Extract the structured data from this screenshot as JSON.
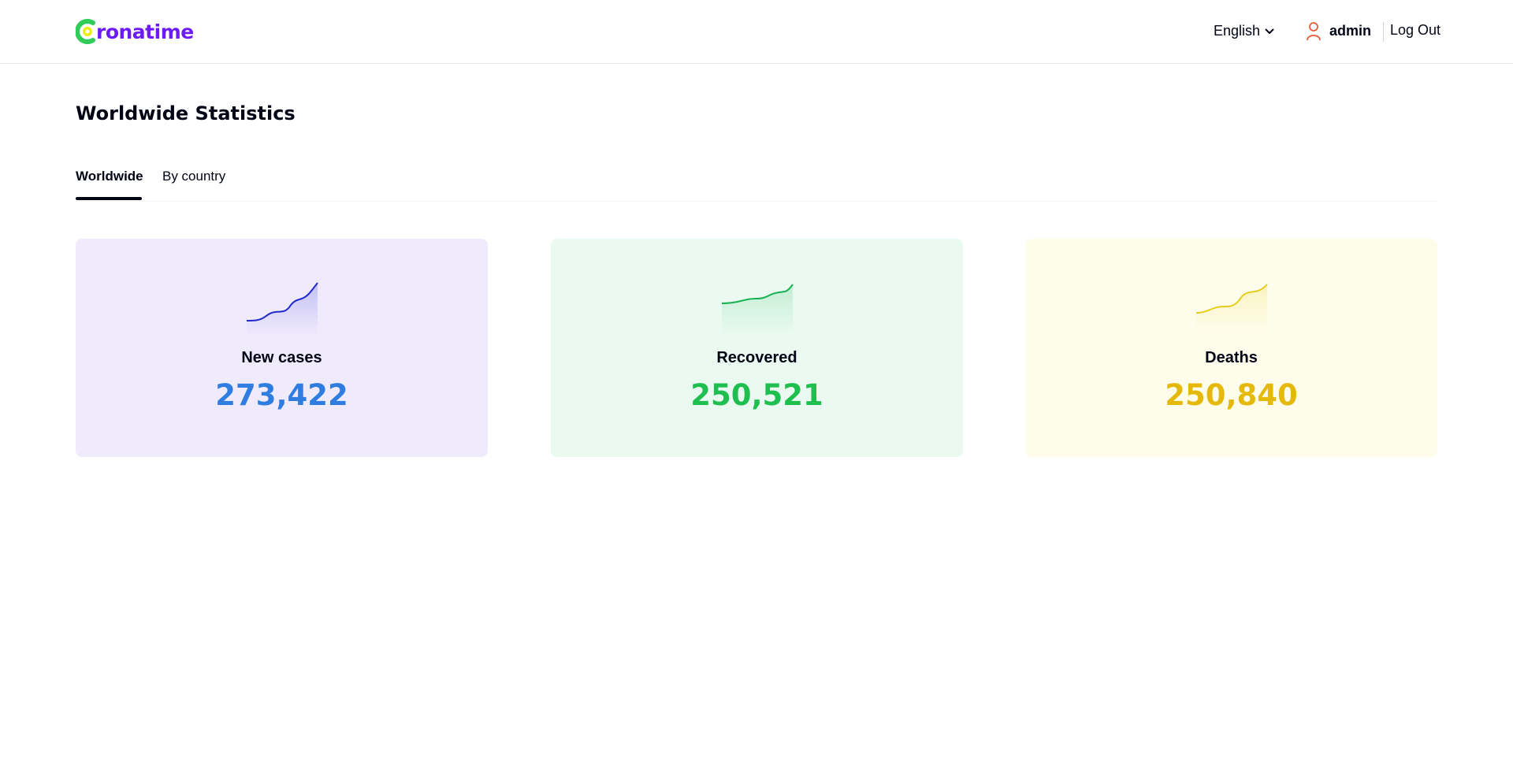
{
  "header": {
    "logo_text": "ronatime",
    "language": "English",
    "user_name": "admin",
    "logout_label": "Log Out"
  },
  "page": {
    "title": "Worldwide Statistics"
  },
  "tabs": [
    {
      "label": "Worldwide",
      "active": true
    },
    {
      "label": "By country",
      "active": false
    }
  ],
  "stats": [
    {
      "label": "New cases",
      "value": "273,422",
      "color": "#2f7de1",
      "card_bg": "#f0eafd",
      "line_color": "#2029c9"
    },
    {
      "label": "Recovered",
      "value": "250,521",
      "color": "#1ebf4f",
      "card_bg": "#eafaf0",
      "line_color": "#17b153"
    },
    {
      "label": "Deaths",
      "value": "250,840",
      "color": "#e5b90c",
      "card_bg": "#fefdec",
      "line_color": "#e7cd1b"
    }
  ],
  "colors": {
    "brand": "#6c1bf5",
    "logo_green": "#2fcc57",
    "logo_yellow": "#eaed12",
    "user_icon": "#e55b34"
  }
}
